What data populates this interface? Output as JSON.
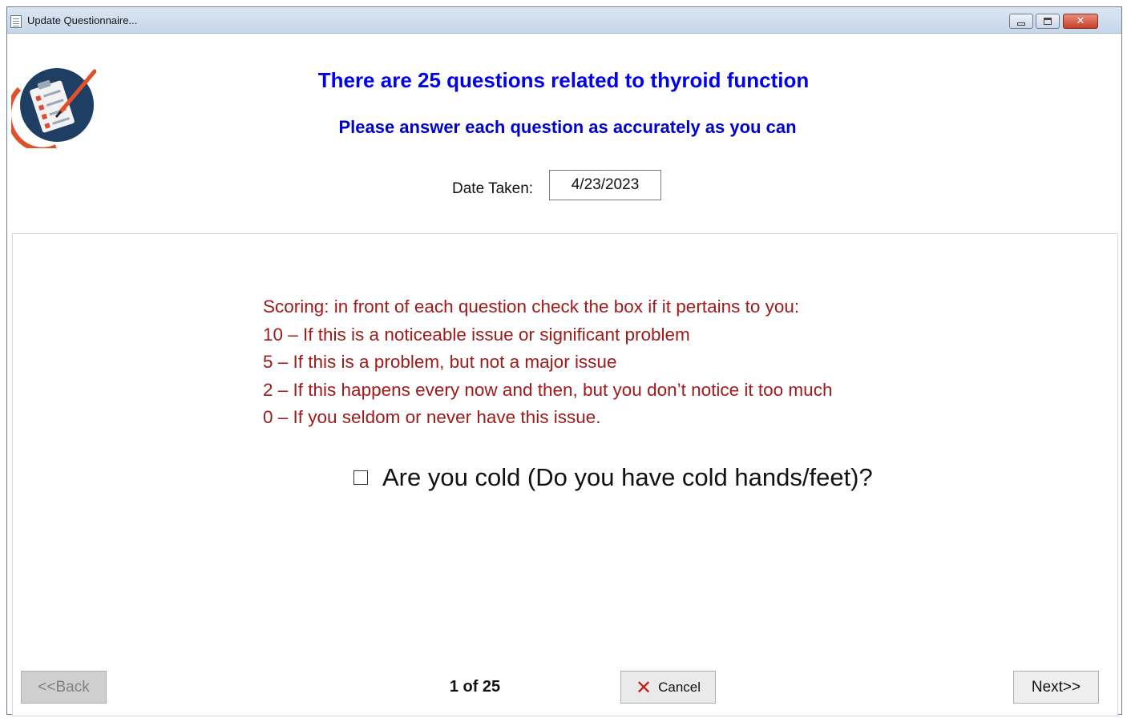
{
  "window": {
    "title": "Update Questionnaire...",
    "controls": {
      "minimize": "minimize-icon",
      "maximize": "maximize-icon",
      "close": "close-icon"
    }
  },
  "header": {
    "logo_icon": "clipboard-checklist-icon",
    "heading": "There are 25 questions related to thyroid function",
    "subheading": "Please answer each question as accurately as you can",
    "date_label": "Date Taken:",
    "date_value": "4/23/2023"
  },
  "scoring": {
    "lines": [
      "Scoring: in front of each question check the box if it pertains to you:",
      "10 – If this is a noticeable issue or significant problem",
      "5 – If this is a problem, but not a major issue",
      "2 – If this happens every now and then, but you don’t notice it too much",
      "0 – If you seldom or never have this issue."
    ]
  },
  "question": {
    "text": "Are you cold (Do you have cold hands/feet)?",
    "checked": false
  },
  "footer": {
    "back_label": "<<Back",
    "page_indicator": "1 of 25",
    "cancel_label": "Cancel",
    "next_label": "Next>>"
  },
  "colors": {
    "heading": "#0000ee",
    "scoring_text": "#a01a1a",
    "cancel_icon": "#c0201a"
  }
}
